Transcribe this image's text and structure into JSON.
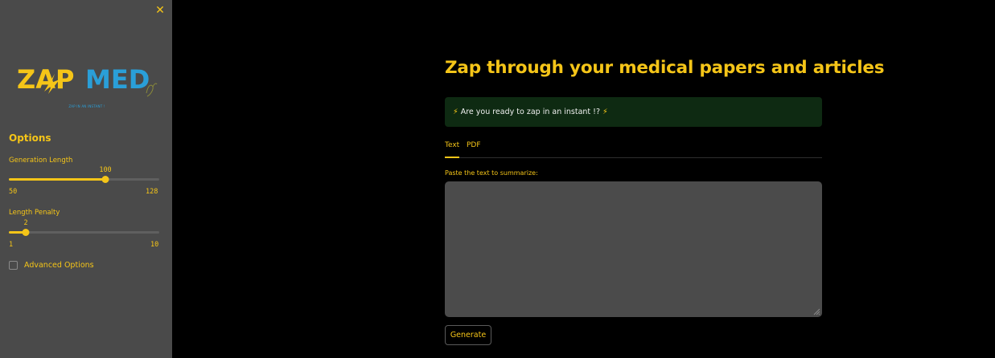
{
  "sidebar": {
    "close_icon": "close-icon",
    "logo": {
      "zap": "ZAP",
      "med": "MED",
      "tagline": "ZAP IN AN INSTANT !",
      "colors": {
        "zap": "#f5c518",
        "med": "#2a9fd8"
      }
    },
    "options_title": "Options",
    "sliders": [
      {
        "label": "Generation Length",
        "value": "100",
        "min": "50",
        "max": "128",
        "fraction": 0.641
      },
      {
        "label": "Length Penalty",
        "value": "2",
        "min": "1",
        "max": "10",
        "fraction": 0.1111
      }
    ],
    "advanced_options": {
      "label": "Advanced Options",
      "checked": false
    }
  },
  "main": {
    "title": "Zap through your medical papers and articles",
    "alert": {
      "text": "Are you ready to zap in an instant !?",
      "icon": "lightning-icon",
      "icon_glyph": "⚡"
    },
    "tabs": [
      {
        "label": "Text",
        "active": true
      },
      {
        "label": "PDF",
        "active": false
      }
    ],
    "textarea": {
      "label": "Paste the text to summarize:",
      "value": "",
      "placeholder": ""
    },
    "generate_button": "Generate"
  },
  "colors": {
    "accent": "#f5c518",
    "sidebar_bg": "#4a4a4a",
    "page_bg": "#000000",
    "alert_bg": "#0e2a12",
    "textarea_bg": "#4b4b4b"
  }
}
